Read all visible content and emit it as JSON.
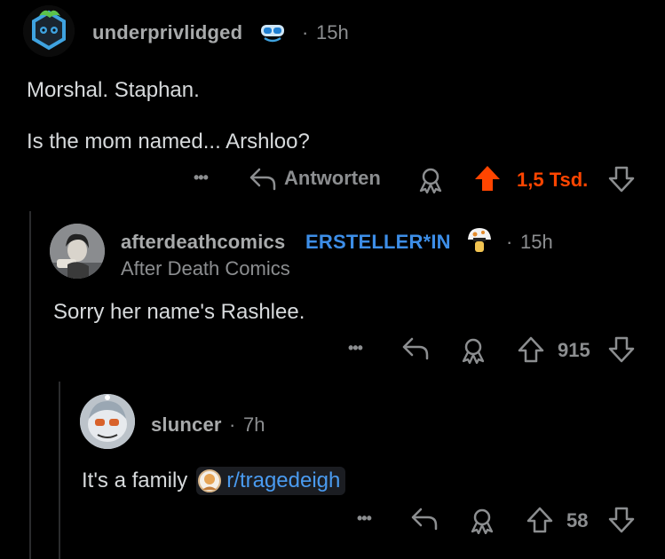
{
  "comments": [
    {
      "username": "underprivlidged",
      "dot": "·",
      "time": "15h",
      "lines": [
        "Morshal. Staphan.",
        "Is the mom named... Arshloo?"
      ],
      "actions": {
        "more": "•••",
        "reply": "Antworten",
        "score": "1,5 Tsd."
      }
    },
    {
      "username": "afterdeathcomics",
      "badge": "ERSTELLER*IN",
      "dot": "·",
      "time": "15h",
      "flair": "After Death Comics",
      "lines": [
        "Sorry her name's Rashlee."
      ],
      "actions": {
        "more": "•••",
        "score": "915"
      }
    },
    {
      "username": "sluncer",
      "dot": "·",
      "time": "7h",
      "text_prefix": "It's a family",
      "subreddit": "r/tragedeigh",
      "actions": {
        "more": "•••",
        "score": "58"
      }
    }
  ],
  "colors": {
    "background": "#000000",
    "text": "#d7dadc",
    "muted": "#8c8e90",
    "upvoted": "#ff4500",
    "op_badge": "#3d8ee8",
    "link": "#4a9bf0"
  },
  "icons": [
    "snoo-avatar-icon",
    "verified-goggles-icon",
    "reply-arrow-icon",
    "award-icon",
    "upvote-icon",
    "downvote-icon",
    "mushroom-icon"
  ]
}
